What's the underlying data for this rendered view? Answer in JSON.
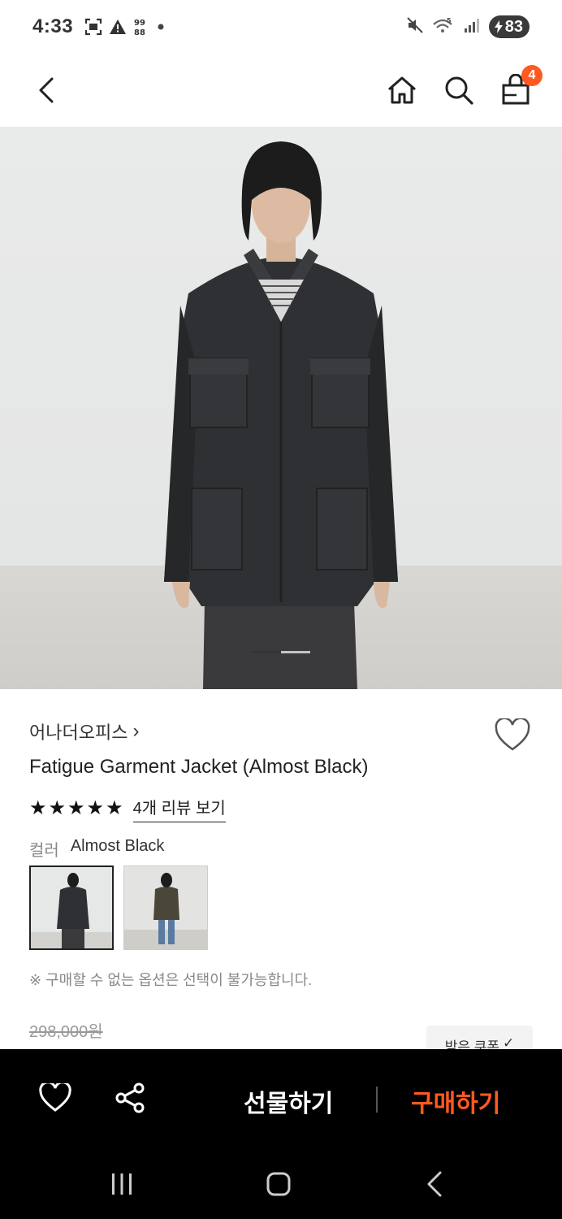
{
  "status_bar": {
    "time": "4:33",
    "battery": "83",
    "left_icons": [
      "screenshot-icon",
      "warning-icon",
      "dual-sim-icon",
      "dot-icon"
    ],
    "right_icons": [
      "mute-icon",
      "wifi-5g-icon",
      "signal-icon",
      "battery-icon"
    ]
  },
  "header": {
    "back_icon": "back-arrow-icon",
    "home_icon": "home-icon",
    "search_icon": "search-icon",
    "cart_icon": "shopping-bag-icon",
    "cart_count": "4"
  },
  "product": {
    "brand": "어나더오피스",
    "brand_chevron": "›",
    "name": "Fatigue Garment Jacket (Almost Black)",
    "rating": 5,
    "review_link": "4개 리뷰 보기",
    "color_label": "컬러",
    "color_value": "Almost Black",
    "colors": [
      "Almost Black",
      "Olive"
    ],
    "option_note": "※ 구매할 수 없는 옵션은 선택이 불가능합니다.",
    "original_price": "298,000원",
    "coupon_label": "받은 쿠폰",
    "coupon_check": "✓"
  },
  "bottom_bar": {
    "wish_icon": "heart-icon",
    "share_icon": "share-icon",
    "gift_label": "선물하기",
    "buy_label": "구매하기"
  },
  "colors": {
    "accent": "#ff5a1f",
    "bar_bg": "#000000"
  }
}
